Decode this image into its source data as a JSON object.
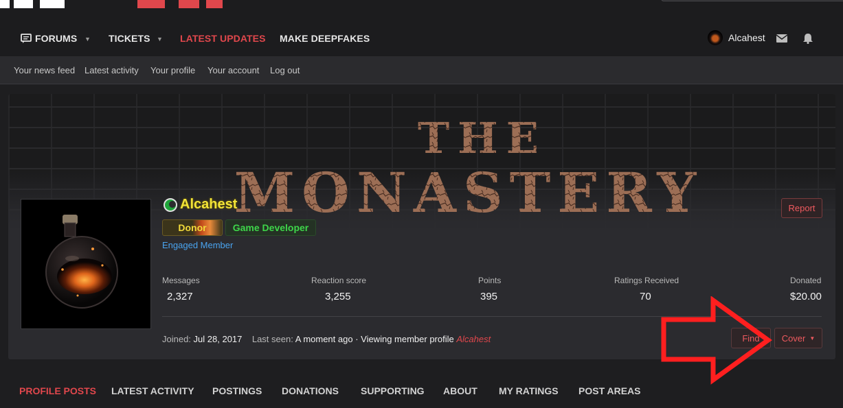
{
  "nav": {
    "items": [
      {
        "label": "FORUMS",
        "has_dropdown": true
      },
      {
        "label": "TICKETS",
        "has_dropdown": true
      },
      {
        "label": "LATEST UPDATES",
        "active": true
      },
      {
        "label": "MAKE DEEPFAKES"
      }
    ],
    "user": "Alcahest",
    "icons": [
      "forum-icon",
      "mail-icon",
      "bell-icon"
    ]
  },
  "subnav": [
    "Your news feed",
    "Latest activity",
    "Your profile",
    "Your account",
    "Log out"
  ],
  "profile": {
    "username": "Alcahest",
    "banners": [
      "Donor",
      "Game Developer"
    ],
    "title": "Engaged Member",
    "report_label": "Report",
    "stats": [
      {
        "label": "Messages",
        "value": "2,327"
      },
      {
        "label": "Reaction score",
        "value": "3,255"
      },
      {
        "label": "Points",
        "value": "395"
      },
      {
        "label": "Ratings Received",
        "value": "70"
      },
      {
        "label": "Donated",
        "value": "$20.00"
      }
    ],
    "joined_label": "Joined:",
    "joined_value": "Jul 28, 2017",
    "last_seen_label": "Last seen:",
    "last_seen_value": "A moment ago · Viewing member profile",
    "last_seen_link": "Alcahest",
    "find_label": "Find",
    "cover_label": "Cover"
  },
  "cover_text": {
    "line1": "THE",
    "line2": "MONASTERY"
  },
  "tabs": [
    {
      "label": "PROFILE POSTS",
      "active": true
    },
    {
      "label": "LATEST ACTIVITY"
    },
    {
      "label": "POSTINGS"
    },
    {
      "label": "DONATIONS"
    },
    {
      "label": "SUPPORTING"
    },
    {
      "label": "ABOUT"
    },
    {
      "label": "MY RATINGS"
    },
    {
      "label": "POST AREAS"
    }
  ],
  "colors": {
    "accent": "#e0474c",
    "username": "#f2e437",
    "dev_green": "#3ed64a",
    "title_blue": "#4aa4f0",
    "arrow": "#ff1f1f"
  }
}
